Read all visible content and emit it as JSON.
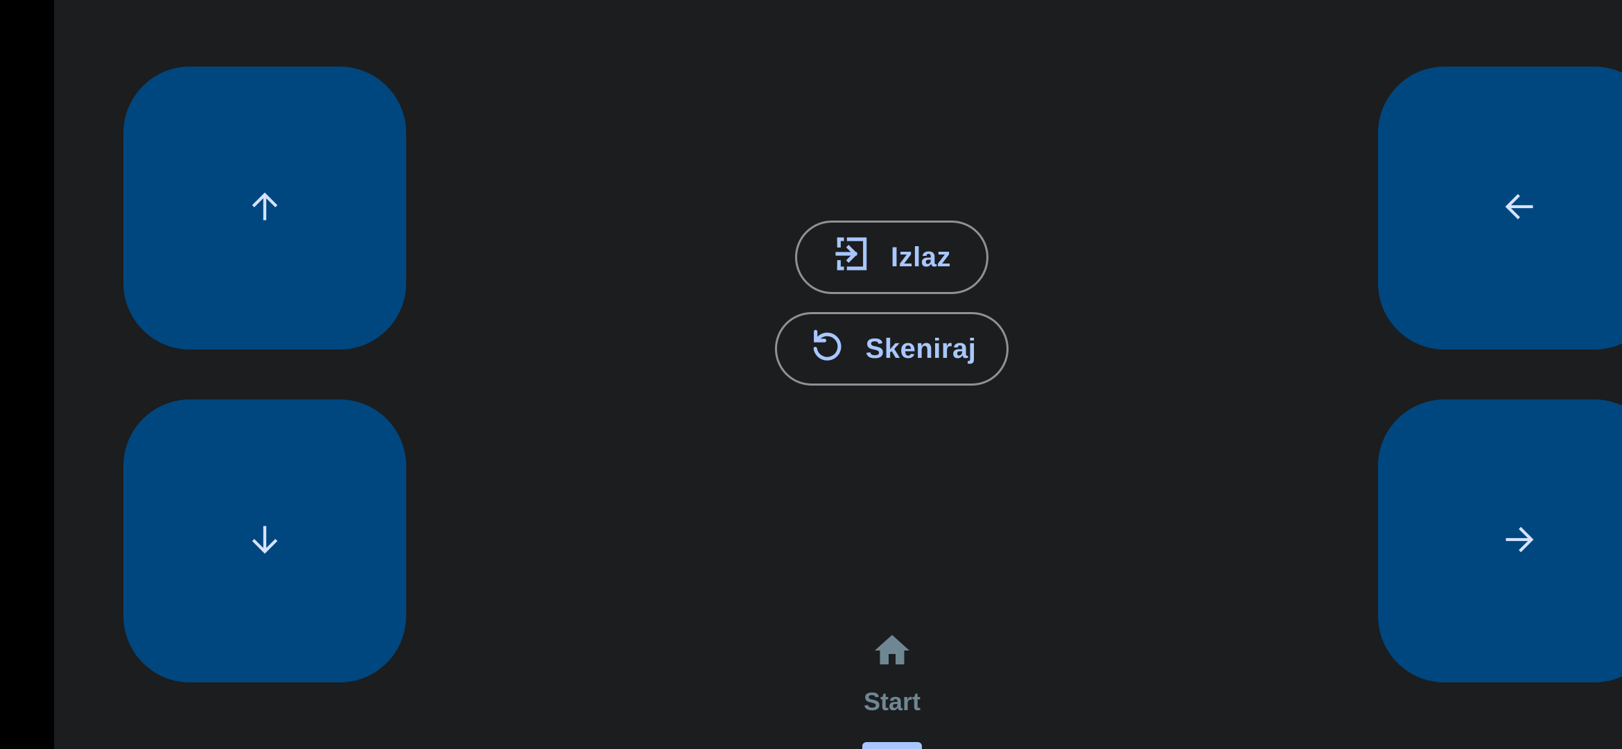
{
  "colors": {
    "background": "#1c1d1f",
    "dpad_fill": "#00477f",
    "dpad_icon": "#d6e3ff",
    "accent": "#a9c7ff",
    "outline": "#8e9196",
    "nav_inactive": "#6f8793"
  },
  "dpad": {
    "up": {
      "icon": "arrow-up-icon"
    },
    "down": {
      "icon": "arrow-down-icon"
    },
    "left": {
      "icon": "arrow-left-icon"
    },
    "right": {
      "icon": "arrow-right-icon"
    }
  },
  "actions": {
    "exit": {
      "label": "Izlaz",
      "icon": "login-exit-icon"
    },
    "scan": {
      "label": "Skeniraj",
      "icon": "refresh-icon"
    }
  },
  "bottom_nav": {
    "items": [
      {
        "label": "Start",
        "icon": "home-icon",
        "selected": true
      }
    ]
  }
}
